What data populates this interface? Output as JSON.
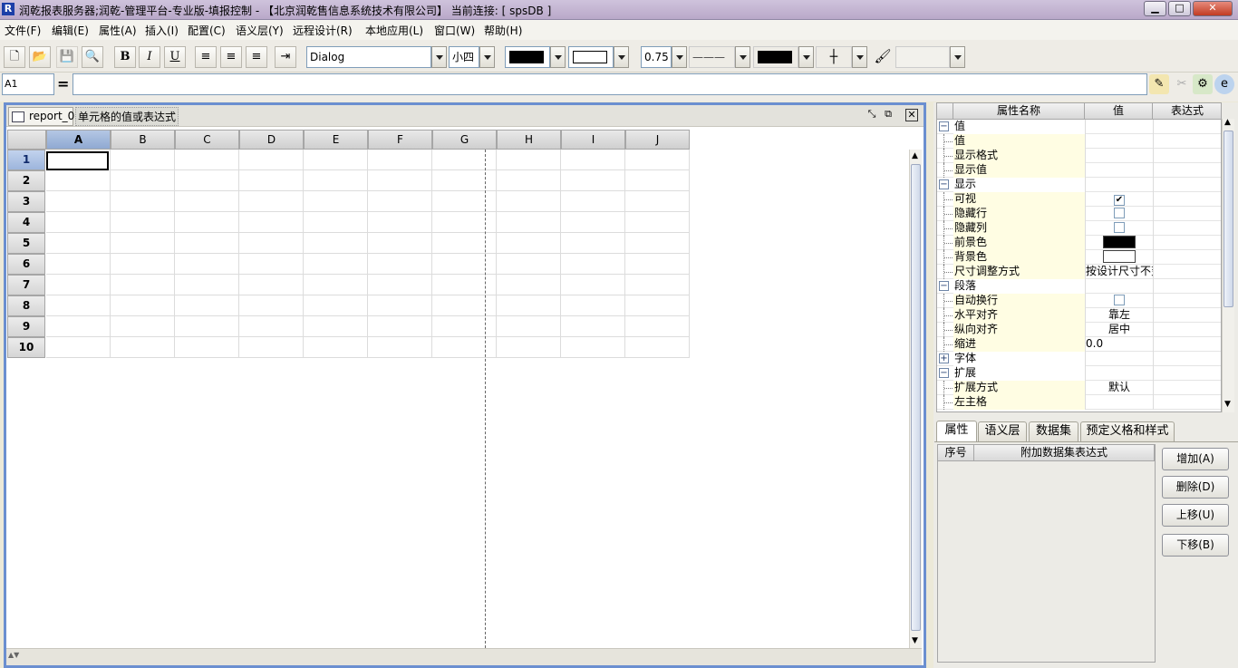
{
  "window": {
    "title": "润乾报表服务器;润乾-管理平台-专业版-填报控制 - 【北京润乾售信息系统技术有限公司】   当前连接: [ spsDB ]",
    "logo_letter": "R",
    "min_label": "▁",
    "max_label": "□",
    "close_label": "✕"
  },
  "menu": {
    "items": [
      "文件(F)",
      "编辑(E)",
      "属性(A)",
      "插入(I)",
      "配置(C)",
      "语义层(Y)",
      "远程设计(R)",
      "本地应用(L)",
      "窗口(W)",
      "帮助(H)"
    ]
  },
  "toolbar": {
    "new_icon": "🗋",
    "open_icon": "📂",
    "save_icon": "💾",
    "preview_icon": "🔍",
    "bold_label": "B",
    "italic_label": "I",
    "underline_label": "U",
    "font_name": "Dialog",
    "font_size": "小四",
    "line_width": "0.75",
    "line_style": "———"
  },
  "formula": {
    "cell_ref": "A1",
    "eq_label": "="
  },
  "document": {
    "tab_label": "report_0",
    "cell_hint": "单元格的值或表达式",
    "columns": [
      "A",
      "B",
      "C",
      "D",
      "E",
      "F",
      "G",
      "H",
      "I",
      "J"
    ],
    "rows": [
      "1",
      "2",
      "3",
      "4",
      "5",
      "6",
      "7",
      "8",
      "9",
      "10"
    ],
    "selected_cell": "A1"
  },
  "properties": {
    "headers": {
      "name": "属性名称",
      "value": "值",
      "expr": "表达式"
    },
    "rows": [
      {
        "name": "值",
        "type": "category",
        "toggle": "−",
        "value": ""
      },
      {
        "name": "值",
        "type": "child",
        "value": ""
      },
      {
        "name": "显示格式",
        "type": "child",
        "value": ""
      },
      {
        "name": "显示值",
        "type": "child",
        "value": ""
      },
      {
        "name": "显示",
        "type": "category",
        "toggle": "−",
        "value": ""
      },
      {
        "name": "可视",
        "type": "child",
        "value": "",
        "checkbox": true,
        "checked": true
      },
      {
        "name": "隐藏行",
        "type": "child",
        "value": "",
        "checkbox": true,
        "checked": false
      },
      {
        "name": "隐藏列",
        "type": "child",
        "value": "",
        "checkbox": true,
        "checked": false
      },
      {
        "name": "前景色",
        "type": "child",
        "value": "",
        "color": "#000000"
      },
      {
        "name": "背景色",
        "type": "child",
        "value": "",
        "color": "#ffffff"
      },
      {
        "name": "尺寸调整方式",
        "type": "child",
        "value": "按设计尺寸不变"
      },
      {
        "name": "段落",
        "type": "category",
        "toggle": "−",
        "value": ""
      },
      {
        "name": "自动换行",
        "type": "child",
        "value": "",
        "checkbox": true,
        "checked": false
      },
      {
        "name": "水平对齐",
        "type": "child",
        "value": "靠左"
      },
      {
        "name": "纵向对齐",
        "type": "child",
        "value": "居中"
      },
      {
        "name": "缩进",
        "type": "child",
        "value": "0.0"
      },
      {
        "name": "字体",
        "type": "category",
        "toggle": "+",
        "value": ""
      },
      {
        "name": "扩展",
        "type": "category",
        "toggle": "−",
        "value": ""
      },
      {
        "name": "扩展方式",
        "type": "child",
        "value": "默认"
      },
      {
        "name": "左主格",
        "type": "child",
        "value": ""
      }
    ]
  },
  "bottom_tabs": [
    "属性",
    "语义层",
    "数据集",
    "预定义格和样式"
  ],
  "dataset": {
    "col_index": "序号",
    "col_expr": "附加数据集表达式"
  },
  "side_buttons": {
    "add": "增加(A)",
    "delete": "删除(D)",
    "up": "上移(U)",
    "down": "下移(B)"
  },
  "colors": {
    "accent": "#6b8fd0",
    "selected_header": "#9db5dc"
  }
}
